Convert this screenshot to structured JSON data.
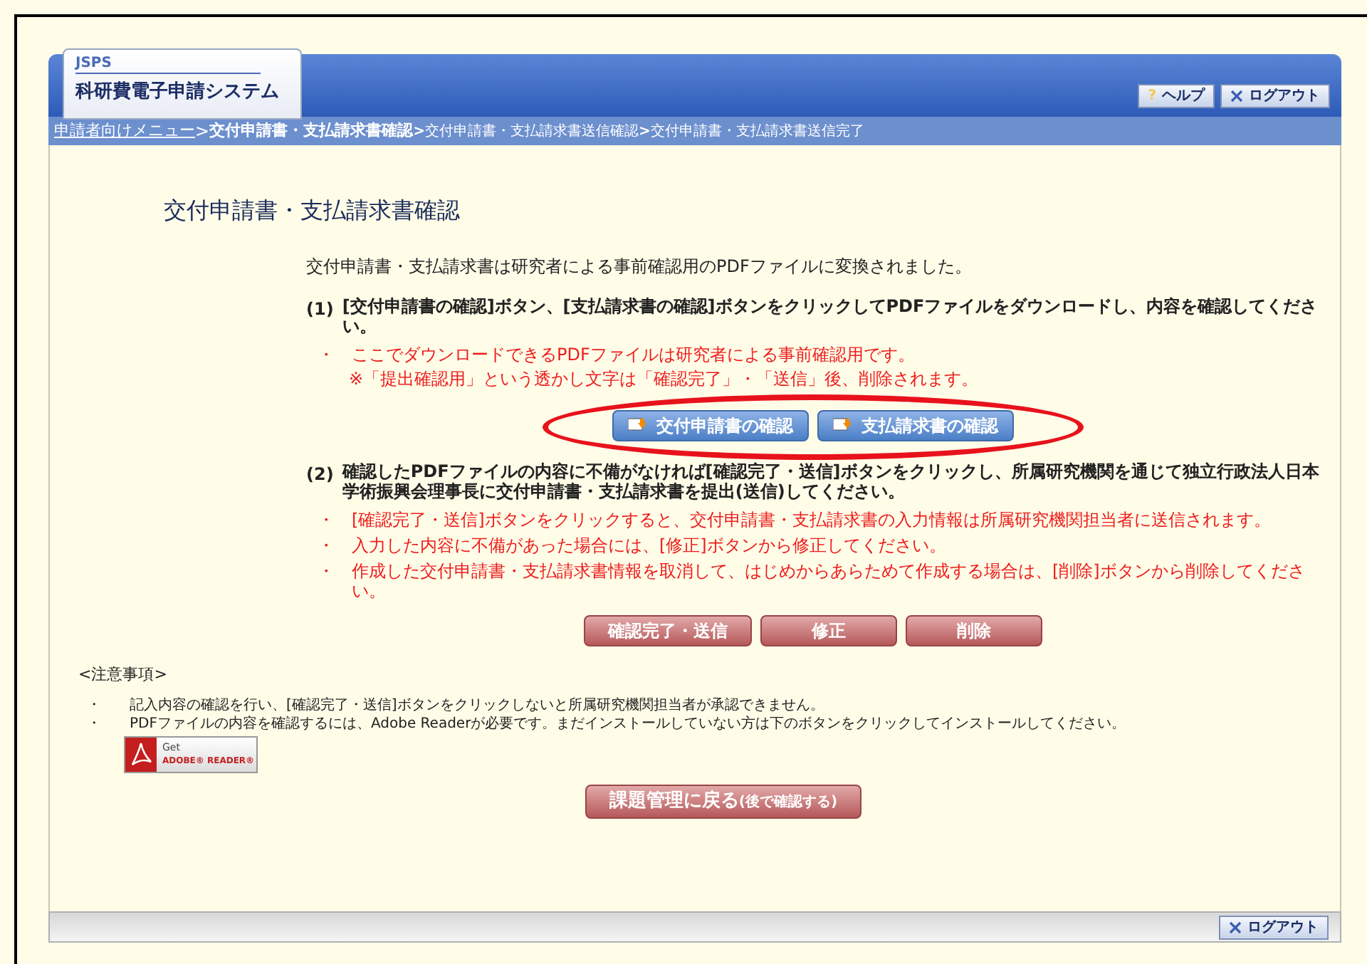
{
  "header": {
    "org": "JSPS",
    "system_name": "科研費電子申請システム",
    "buttons": [
      {
        "kind": "help",
        "icon": "?",
        "label": "ヘルプ"
      },
      {
        "kind": "logout",
        "label": "ログアウト"
      }
    ]
  },
  "breadcrumb": [
    {
      "label": "申請者向けメニュー",
      "kind": "link"
    },
    {
      "separator": ">",
      "label": "交付申請書・支払請求書確認",
      "kind": "current"
    },
    {
      "separator": ">",
      "label": "交付申請書・支払請求書送信確認",
      "kind": "future"
    },
    {
      "separator": ">",
      "label": "交付申請書・支払請求書送信完了",
      "kind": "future"
    }
  ],
  "page_title": "交付申請書・支払請求書確認",
  "intro": "交付申請書・支払請求書は研究者による事前確認用のPDFファイルに変換されました。",
  "steps": [
    {
      "number": "(1)",
      "text": "[交付申請書の確認]ボタン、[支払請求書の確認]ボタンをクリックしてPDFファイルをダウンロードし、内容を確認してください。",
      "notes": [
        {
          "kind": "bullet",
          "bullet": "・",
          "text": "ここでダウンロードできるPDFファイルは研究者による事前確認用です。"
        },
        {
          "kind": "plain",
          "text": "※「提出確認用」という透かし文字は「確認完了」・「送信」後、削除されます。"
        }
      ],
      "buttons": [
        {
          "kind": "download",
          "label": "交付申請書の確認"
        },
        {
          "kind": "download",
          "label": "支払請求書の確認"
        }
      ],
      "highlighted": true
    },
    {
      "number": "(2)",
      "text": "確認したPDFファイルの内容に不備がなければ[確認完了・送信]ボタンをクリックし、所属研究機関を通じて独立行政法人日本学術振興会理事長に交付申請書・支払請求書を提出(送信)してください。",
      "notes": [
        {
          "kind": "bullet",
          "bullet": "・",
          "text": "[確認完了・送信]ボタンをクリックすると、交付申請書・支払請求書の入力情報は所属研究機関担当者に送信されます。"
        },
        {
          "kind": "bullet",
          "bullet": "・",
          "text": "入力した内容に不備があった場合には、[修正]ボタンから修正してください。"
        },
        {
          "kind": "bullet",
          "bullet": "・",
          "text": "作成した交付申請書・支払請求書情報を取消して、はじめからあらためて作成する場合は、[削除]ボタンから削除してください。"
        }
      ],
      "buttons": [
        {
          "kind": "action",
          "label": "確認完了・送信"
        },
        {
          "kind": "action",
          "label": "修正"
        },
        {
          "kind": "action",
          "label": "削除"
        }
      ],
      "highlighted": false
    }
  ],
  "notice": {
    "title": "<注意事項>",
    "items": [
      {
        "bullet": "・",
        "text": "記入内容の確認を行い、[確認完了・送信]ボタンをクリックしないと所属研究機関担当者が承認できません。"
      },
      {
        "bullet": "・",
        "text": "PDFファイルの内容を確認するには、Adobe Readerが必要です。まだインストールしていない方は下のボタンをクリックしてインストールしてください。"
      }
    ],
    "badge": {
      "small": "Get",
      "brand": "ADOBE® READER®"
    }
  },
  "back_button": {
    "label": "課題管理に戻る",
    "sub": "(後で確認する)"
  },
  "footer": {
    "buttons": [
      {
        "kind": "logout",
        "label": "ログアウト"
      }
    ]
  }
}
